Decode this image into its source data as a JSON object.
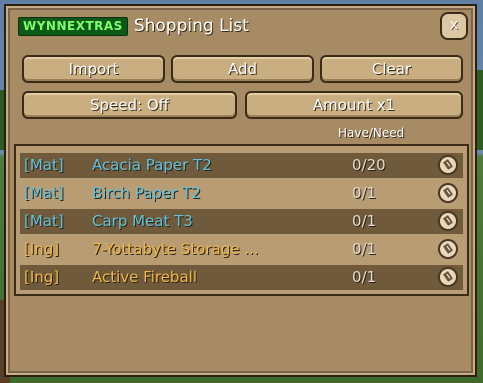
{
  "window": {
    "logo": "WYNNEXTRAS",
    "title": "Shopping List",
    "close_label": "x"
  },
  "toolbar": {
    "import_label": "Import",
    "add_label": "Add",
    "clear_label": "Clear",
    "speed_label": "Speed: Off",
    "amount_label": "Amount x1"
  },
  "list": {
    "column_header": "Have/Need",
    "rows": [
      {
        "tag": "[Mat]",
        "name": "Acacia Paper T2",
        "qty": "0/20",
        "kind": "mat",
        "shade": "dark",
        "icon": "edit-icon"
      },
      {
        "tag": "[Mat]",
        "name": "Birch Paper T2",
        "qty": "0/1",
        "kind": "mat",
        "shade": "light",
        "icon": "edit-icon"
      },
      {
        "tag": "[Mat]",
        "name": "Carp Meat T3",
        "qty": "0/1",
        "kind": "mat",
        "shade": "dark",
        "icon": "edit-icon"
      },
      {
        "tag": "[Ing]",
        "name": "7-Yottabyte Storage ...",
        "qty": "0/1",
        "kind": "ing",
        "shade": "light",
        "icon": "edit-icon"
      },
      {
        "tag": "[Ing]",
        "name": "Active Fireball",
        "qty": "0/1",
        "kind": "ing",
        "shade": "dark",
        "icon": "edit-icon"
      }
    ]
  },
  "colors": {
    "mat": "#63c3dd",
    "ing": "#f0b84a",
    "panel": "#a68b65"
  }
}
